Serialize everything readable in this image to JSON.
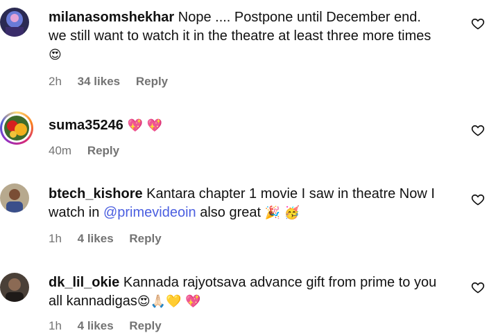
{
  "comments": [
    {
      "username": "milanasomshekhar",
      "text": "Nope .... Postpone until December end.",
      "text2": "we still want to watch it in the theatre at least three more times",
      "emoji": "😍",
      "time": "2h",
      "likes": "34 likes",
      "reply": "Reply"
    },
    {
      "username": "suma35246",
      "emoji": "💖 💖",
      "time": "40m",
      "reply": "Reply"
    },
    {
      "username": "btech_kishore",
      "text": "Kantara chapter 1 movie I saw in theatre Now I",
      "text2_pre": "watch in ",
      "mention": "@primevideoin",
      "text2_post": " also great",
      "emoji": "🎉 🥳",
      "time": "1h",
      "likes": "4 likes",
      "reply": "Reply"
    },
    {
      "username": "dk_lil_okie",
      "text": "Kannada rajyotsava advance gift from prime to you",
      "text2": "all kannadigas",
      "emoji": "😍🙏🏻💛 💖",
      "time": "1h",
      "likes": "4 likes",
      "reply": "Reply"
    }
  ],
  "icons": {
    "like": "heart-outline-icon"
  },
  "colors": {
    "meta": "#737373",
    "mention": "#4a5ee0"
  }
}
